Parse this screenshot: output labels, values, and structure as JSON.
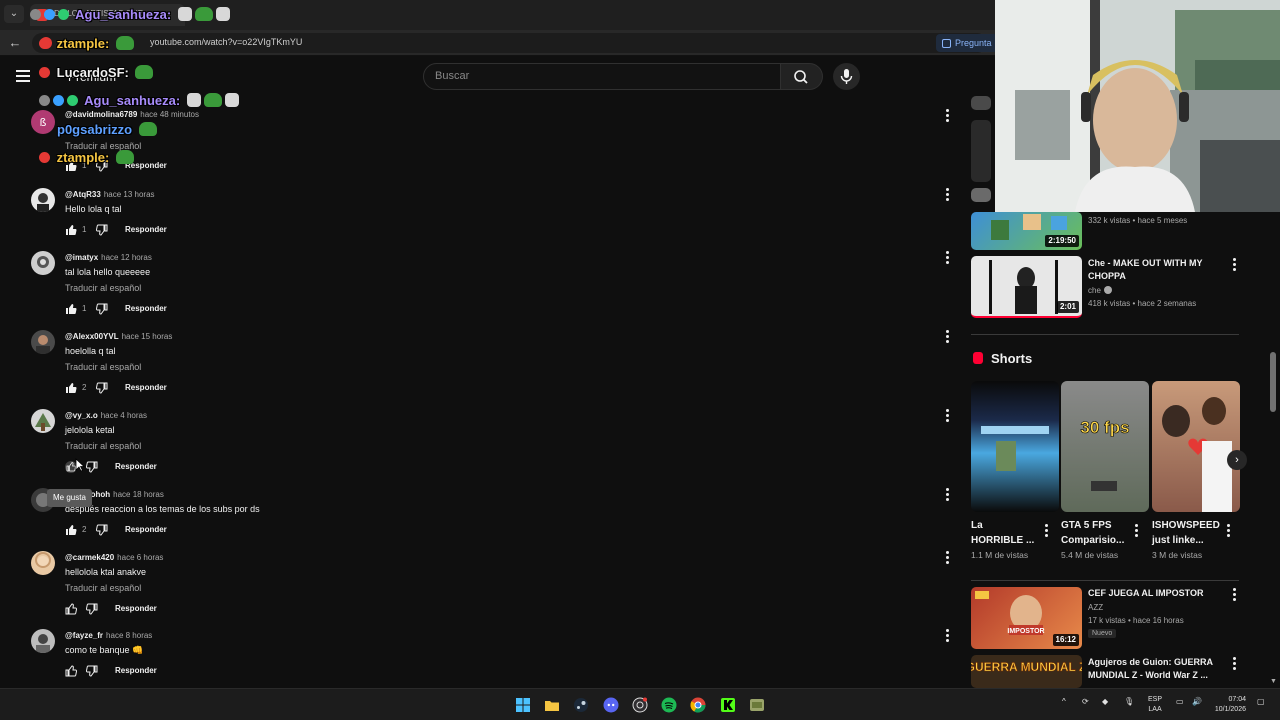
{
  "browser": {
    "tab_title": "DE LOS ARTISTAS QUE...",
    "url": "youtube.com/watch?v=o22VIgTKmYU",
    "ask_button": "Pregunta"
  },
  "header": {
    "logo_label": "Premium",
    "search_placeholder": "Buscar"
  },
  "chat_overlay": [
    {
      "user": "Agu_sanhueza:",
      "color": "#a78bfa"
    },
    {
      "user": "ztample:",
      "color": "#f5c542"
    },
    {
      "user": "LucardoSF:",
      "color": "#f1f1f1"
    },
    {
      "user": "Agu_sanhueza:",
      "color": "#a78bfa"
    },
    {
      "user": "p0gsabrizzo",
      "color": "#5ea0ff"
    },
    {
      "user": "ztample:",
      "color": "#f5c542"
    }
  ],
  "comments": [
    {
      "author": "@davidmolina6789",
      "time": "hace 48 minutos",
      "text": "",
      "translate": "Traducir al español",
      "likes": "1",
      "reply": "Responder"
    },
    {
      "author": "@AtqR33",
      "time": "hace 13 horas",
      "text": "Hello lola q tal",
      "translate": "",
      "likes": "1",
      "reply": "Responder"
    },
    {
      "author": "@imatyx",
      "time": "hace 12 horas",
      "text": "tal lola hello queeeee",
      "translate": "Traducir al español",
      "likes": "1",
      "reply": "Responder"
    },
    {
      "author": "@Alexx00YVL",
      "time": "hace 15 horas",
      "text": "hoelolla q tal",
      "translate": "Traducir al español",
      "likes": "2",
      "reply": "Responder"
    },
    {
      "author": "@vy_x.o",
      "time": "hace 4 horas",
      "text": "jelololа ketal",
      "translate": "Traducir al español",
      "likes": "",
      "reply": "Responder"
    },
    {
      "author": "@...owohoh",
      "time": "hace 18 horas",
      "text": "después reaccion a los temas de los subs por ds",
      "translate": "",
      "likes": "2",
      "reply": "Responder"
    },
    {
      "author": "@carmek420",
      "time": "hace 6 horas",
      "text": "hellolola ktal anakve",
      "translate": "Traducir al español",
      "likes": "",
      "reply": "Responder"
    },
    {
      "author": "@fayze_fr",
      "time": "hace 8 horas",
      "text": "como te banque 👊",
      "translate": "",
      "likes": "",
      "reply": "Responder"
    }
  ],
  "tooltip": "Me gusta",
  "sidebar": {
    "video1": {
      "meta": "332 k vistas • hace 5 meses",
      "duration": "2:19:50"
    },
    "video2": {
      "title": "Che - MAKE OUT WITH MY CHOPPA",
      "channel": "che",
      "meta": "418 k vistas • hace 2 semanas",
      "duration": "2:01"
    },
    "shorts_title": "Shorts",
    "shorts": [
      {
        "title": "La HORRIBLE ...",
        "views": "1.1 M de vistas",
        "overlay": ""
      },
      {
        "title": "GTA 5 FPS Comparisio...",
        "views": "5.4 M de vistas",
        "overlay": "30 fps"
      },
      {
        "title": "ISHOWSPEED just linke...",
        "views": "3 M de vistas",
        "overlay": ""
      }
    ],
    "video3": {
      "title": "CEF JUEGA AL IMPOSTOR",
      "channel": "AZZ",
      "meta": "17 k vistas • hace 16 horas",
      "badge": "Nuevo",
      "duration": "16:12",
      "thumb_text": "IMPOSTOR"
    },
    "video4": {
      "title": "Agujeros de Guion: GUERRA MUNDIAL Z - World War Z ...",
      "thumb_text": "GUERRA MUNDIAL Z"
    }
  },
  "taskbar": {
    "lang_top": "ESP",
    "lang_bottom": "LAA",
    "time": "07:04",
    "date": "10/1/2026"
  },
  "colors": {
    "background": "#0f0f0f",
    "accent_red": "#ff0033",
    "muted_text": "#aaaaaa"
  }
}
